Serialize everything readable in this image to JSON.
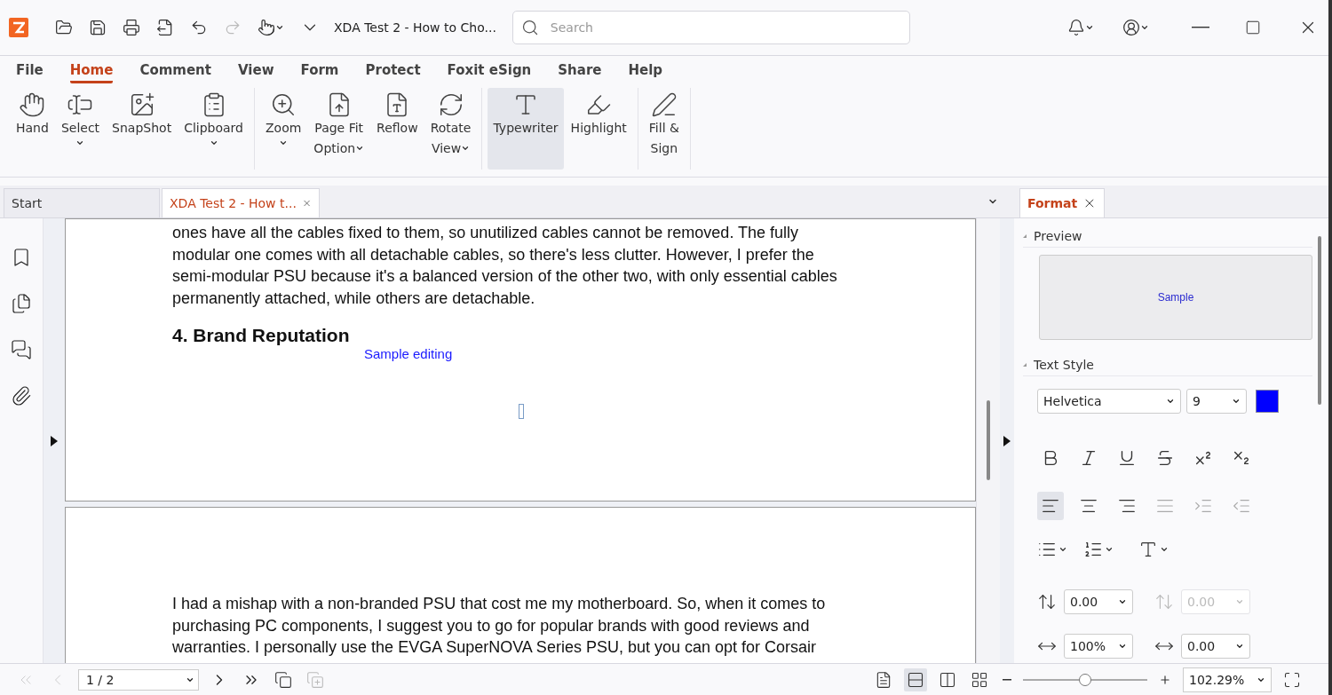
{
  "title_bar": {
    "document_title": "XDA Test 2 - How to Cho...",
    "search": {
      "placeholder": "Search"
    }
  },
  "menu_tabs": [
    {
      "label": "File",
      "selected": false
    },
    {
      "label": "Home",
      "selected": true
    },
    {
      "label": "Comment",
      "selected": false
    },
    {
      "label": "View",
      "selected": false
    },
    {
      "label": "Form",
      "selected": false
    },
    {
      "label": "Protect",
      "selected": false
    },
    {
      "label": "Foxit eSign",
      "selected": false
    },
    {
      "label": "Share",
      "selected": false
    },
    {
      "label": "Help",
      "selected": false
    }
  ],
  "ribbon_groups": [
    {
      "tools": [
        {
          "lines": [
            "Hand"
          ],
          "dropdown": false,
          "selected": false
        },
        {
          "lines": [
            "Select"
          ],
          "dropdown": true,
          "selected": false
        },
        {
          "lines": [
            "SnapShot"
          ],
          "dropdown": false,
          "selected": false
        },
        {
          "lines": [
            "Clipboard"
          ],
          "dropdown": true,
          "selected": false
        }
      ]
    },
    {
      "tools": [
        {
          "lines": [
            "Zoom"
          ],
          "dropdown": true,
          "selected": false
        },
        {
          "lines": [
            "Page Fit",
            "Option"
          ],
          "dropdown": true,
          "selected": false
        },
        {
          "lines": [
            "Reflow"
          ],
          "dropdown": false,
          "selected": false
        },
        {
          "lines": [
            "Rotate",
            "View"
          ],
          "dropdown": true,
          "selected": false
        }
      ]
    },
    {
      "tools": [
        {
          "lines": [
            "Typewriter"
          ],
          "dropdown": false,
          "selected": true
        },
        {
          "lines": [
            "Highlight"
          ],
          "dropdown": false,
          "selected": false
        }
      ]
    },
    {
      "tools": [
        {
          "lines": [
            "Fill &",
            "Sign"
          ],
          "dropdown": false,
          "selected": false
        }
      ]
    }
  ],
  "doc_tabs": [
    {
      "label": "Start",
      "selected": false,
      "closable": false
    },
    {
      "label": "XDA Test 2 - How t...",
      "selected": true,
      "closable": true
    }
  ],
  "pages": [
    {
      "paragraph": "ones have all the cables fixed to them, so unutilized cables cannot be removed. The fully modular one comes with all detachable cables, so there's less clutter. However, I prefer the semi-modular PSU because it's a balanced version of the other two, with only essential cables permanently attached, while others are detachable.",
      "heading": "4. Brand Reputation",
      "annotation": "Sample editing"
    },
    {
      "paragraph": "I had a mishap with a non-branded PSU that cost me my motherboard. So, when it comes to purchasing PC components, I suggest you to go for popular brands with good reviews and warranties. I personally use the EVGA SuperNOVA Series PSU, but you can opt for Corsair"
    }
  ],
  "format_panel": {
    "tab": {
      "label": "Format",
      "selected": true
    },
    "preview": {
      "title": "Preview",
      "sample": "Sample"
    },
    "text_style": {
      "title": "Text Style",
      "font": "Helvetica",
      "size": "9",
      "color": "#0000ff",
      "style_buttons": [
        {
          "selected": false,
          "disabled": false
        },
        {
          "selected": false,
          "disabled": false
        },
        {
          "selected": false,
          "disabled": false
        },
        {
          "selected": false,
          "disabled": false
        },
        {
          "selected": false,
          "disabled": false
        },
        {
          "selected": false,
          "disabled": false
        }
      ],
      "align_buttons": [
        {
          "selected": true,
          "disabled": false
        },
        {
          "selected": false,
          "disabled": false
        },
        {
          "selected": false,
          "disabled": false
        },
        {
          "selected": false,
          "disabled": true
        },
        {
          "selected": false,
          "disabled": true
        },
        {
          "selected": false,
          "disabled": true
        }
      ],
      "spacing_fields": [
        {
          "value": "0.00",
          "disabled": false
        },
        {
          "value": "0.00",
          "disabled": true
        },
        {
          "value": "100%",
          "disabled": false
        },
        {
          "value": "0.00",
          "disabled": false
        }
      ]
    }
  },
  "status_bar": {
    "nav_buttons": [
      {
        "disabled": true
      },
      {
        "disabled": true
      },
      {
        "disabled": false
      },
      {
        "disabled": false
      }
    ],
    "page_field": "1 / 2",
    "view_modes": [
      {
        "selected": false
      },
      {
        "selected": true
      },
      {
        "selected": false
      },
      {
        "selected": false
      }
    ],
    "zoom_slider": {
      "level": 0.5
    },
    "zoom_value": "102.29%"
  }
}
